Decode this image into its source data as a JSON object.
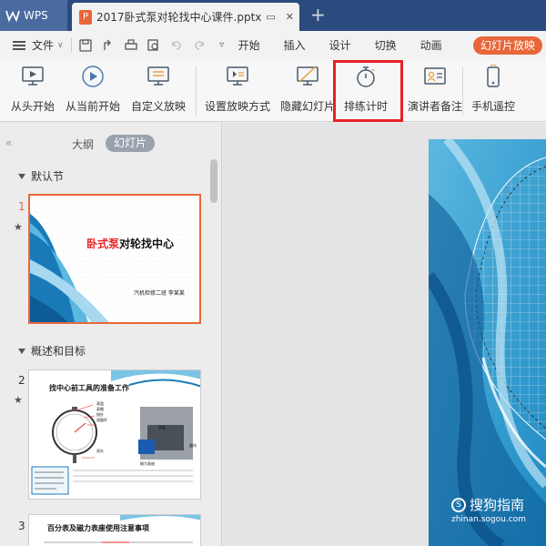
{
  "titlebar": {
    "app_name": "WPS",
    "doc_title": "2017卧式泵对轮找中心课件.pptx",
    "new_tab_symbol": "+"
  },
  "menubar": {
    "file_label": "文件",
    "items": [
      "开始",
      "插入",
      "设计",
      "切换",
      "动画"
    ],
    "active_tab": "幻灯片放映",
    "accent_color": "#e8673a"
  },
  "ribbon": {
    "buttons": [
      {
        "label": "从头开始",
        "icon": "play-from-start-icon"
      },
      {
        "label": "从当前开始",
        "icon": "play-from-current-icon"
      },
      {
        "label": "自定义放映",
        "icon": "custom-show-icon"
      },
      {
        "label": "设置放映方式",
        "icon": "setup-show-icon"
      },
      {
        "label": "隐藏幻灯片",
        "icon": "hide-slide-icon"
      },
      {
        "label": "排练计时",
        "icon": "stopwatch-icon"
      },
      {
        "label": "演讲者备注",
        "icon": "speaker-notes-icon"
      },
      {
        "label": "手机遥控",
        "icon": "phone-remote-icon"
      }
    ],
    "highlight_color": "#e82027"
  },
  "leftpane": {
    "collapse_symbol": "«",
    "outline_tab": "大纲",
    "slides_tab": "幻灯片",
    "sections": [
      "默认节",
      "概述和目标"
    ],
    "slides": [
      {
        "number": "1",
        "title_red": "卧式泵",
        "title_black": "对轮找中心",
        "subtitle": "汽机检修二班 李某某"
      },
      {
        "number": "2",
        "title": "找中心前工具的准备工作",
        "labels": [
          "表盘",
          "表圈",
          "指针",
          "测量杆",
          "测头",
          "磁力表座",
          "表架",
          "量块"
        ]
      },
      {
        "number": "3",
        "title": "百分表及磁力表座使用注意事项"
      }
    ],
    "star_symbol": "★"
  },
  "watermark": {
    "name": "搜狗指南",
    "url": "zhinan.sogou.com"
  }
}
